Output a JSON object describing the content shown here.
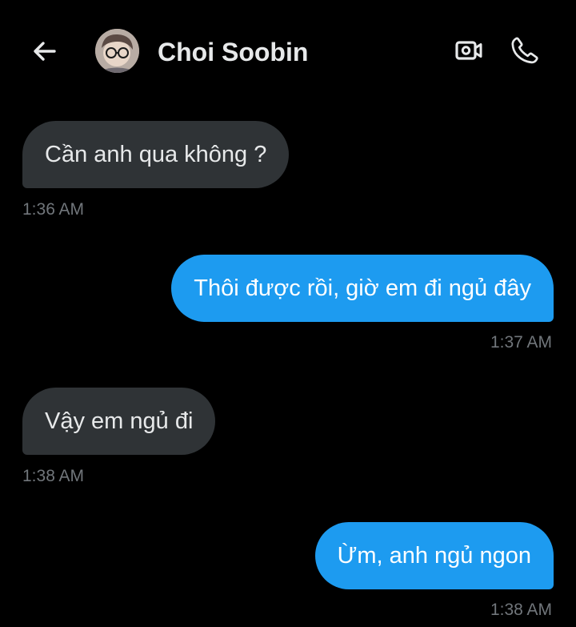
{
  "header": {
    "contact_name": "Choi Soobin",
    "back_icon": "arrow-left-icon",
    "video_icon": "video-camera-icon",
    "call_icon": "phone-icon"
  },
  "colors": {
    "background": "#000000",
    "incoming_bubble": "#2f3336",
    "outgoing_bubble": "#1d9bf0",
    "timestamp": "#71767b",
    "text": "#e7e9ea"
  },
  "messages": [
    {
      "direction": "incoming",
      "text": "Cần anh qua không ?",
      "time": "1:36 AM"
    },
    {
      "direction": "outgoing",
      "text": "Thôi được rồi, giờ em đi ngủ đây",
      "time": "1:37 AM"
    },
    {
      "direction": "incoming",
      "text": "Vậy em ngủ đi",
      "time": "1:38 AM"
    },
    {
      "direction": "outgoing",
      "text": "Ừm, anh ngủ ngon",
      "time": "1:38 AM"
    }
  ]
}
